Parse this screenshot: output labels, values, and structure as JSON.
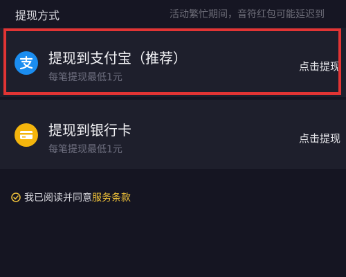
{
  "header": {
    "title": "提现方式",
    "note": "活动繁忙期间，音符红包可能延迟到"
  },
  "options": [
    {
      "title": "提现到支付宝（推荐）",
      "subtitle": "每笔提现最低1元",
      "action": "点击提现",
      "icon": "alipay-icon",
      "color": "#1b8df0"
    },
    {
      "title": "提现到银行卡",
      "subtitle": "每笔提现最低1元",
      "action": "点击提现",
      "icon": "bank-card-icon",
      "color": "#f4b50d"
    }
  ],
  "agreement": {
    "text": "我已阅读并同意",
    "terms_link": "服务条款"
  },
  "colors": {
    "highlight": "#e23434",
    "terms": "#f2c43a"
  }
}
